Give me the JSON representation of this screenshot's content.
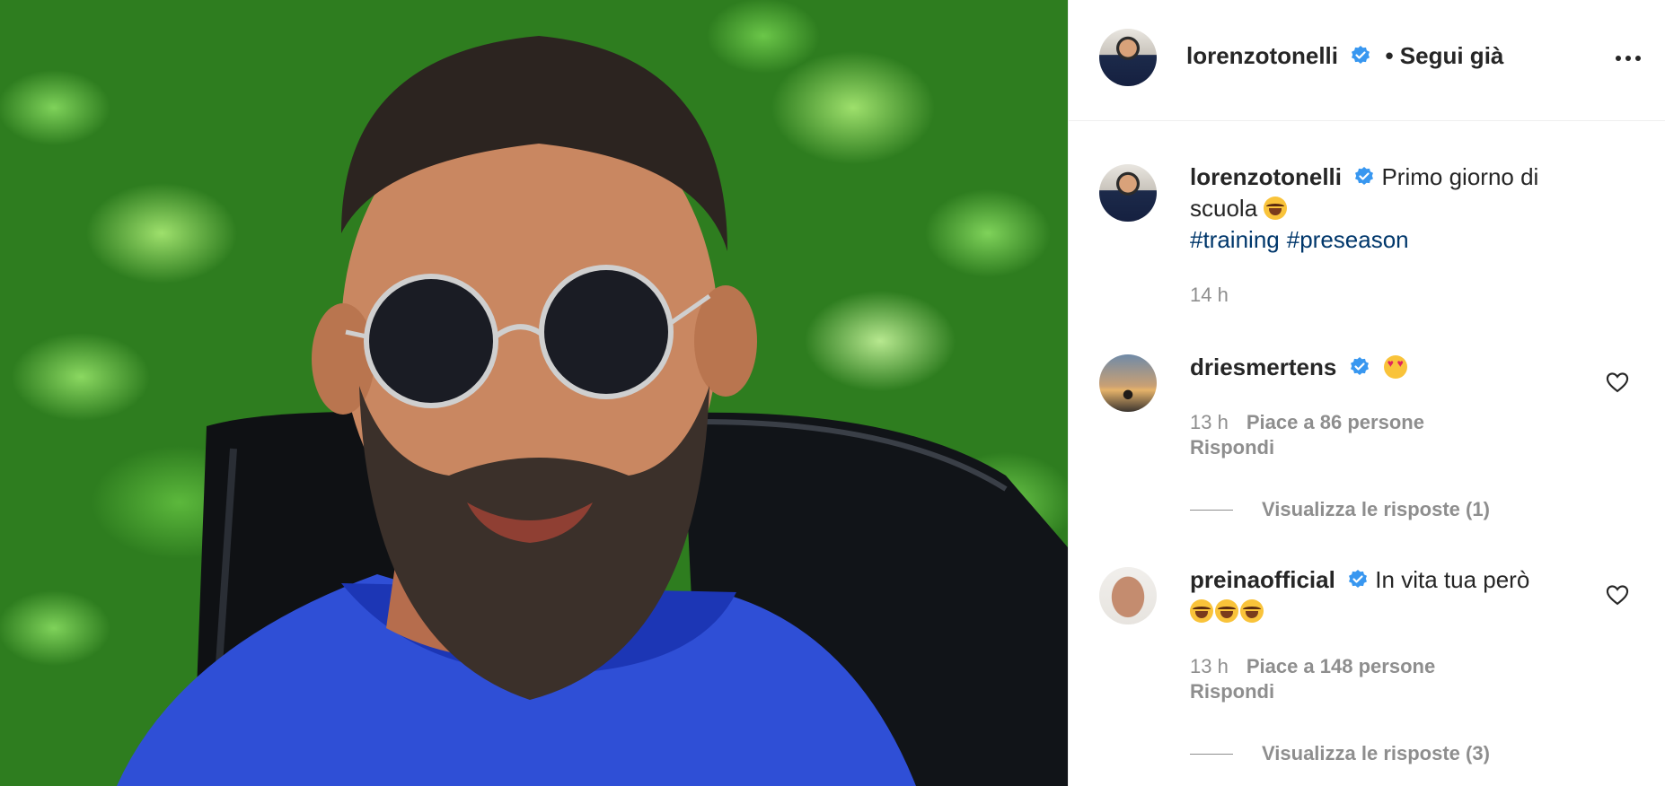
{
  "post": {
    "author": "lorenzotonelli",
    "follow_status": "• Segui già",
    "caption": "Primo giorno di scuola",
    "caption_emoji": "laughing-with-tears",
    "hashtags": [
      "#training",
      "#preseason"
    ],
    "time": "14 h"
  },
  "comments": [
    {
      "username": "driesmertens",
      "text": "",
      "emoji": "heart-eyes",
      "time": "13 h",
      "likes": "Piace a 86 persone",
      "reply_label": "Rispondi",
      "view_replies": "Visualizza le risposte (1)"
    },
    {
      "username": "preinaofficial",
      "text": "In vita tua però",
      "emoji": "rolling-on-floor-laughing x3",
      "time": "13 h",
      "likes": "Piace a 148 persone",
      "reply_label": "Rispondi",
      "view_replies": "Visualizza le risposte (3)"
    }
  ],
  "colors": {
    "verified": "#3897f0",
    "hashtag": "#00376b",
    "muted": "#8e8e8e"
  },
  "icons": [
    "verified-badge-icon",
    "more-options-icon",
    "heart-outline-icon"
  ]
}
